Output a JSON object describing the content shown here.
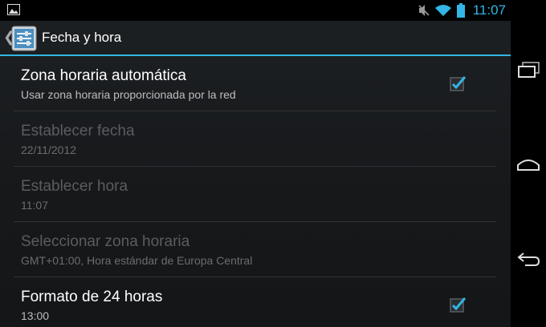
{
  "status_bar": {
    "time": "11:07",
    "icons": [
      "picture-icon",
      "mute-icon",
      "wifi-icon",
      "battery-icon"
    ]
  },
  "action_bar": {
    "title": "Fecha y hora",
    "icon": "settings-sliders-icon"
  },
  "settings": [
    {
      "title": "Zona horaria automática",
      "summary": "Usar zona horaria proporcionada por la red",
      "enabled": true,
      "checkbox": true,
      "checked": true
    },
    {
      "title": "Establecer fecha",
      "summary": "22/11/2012",
      "enabled": false,
      "checkbox": false
    },
    {
      "title": "Establecer hora",
      "summary": "11:07",
      "enabled": false,
      "checkbox": false
    },
    {
      "title": "Seleccionar zona horaria",
      "summary": "GMT+01:00, Hora estándar de Europa Central",
      "enabled": false,
      "checkbox": false
    },
    {
      "title": "Formato de 24 horas",
      "summary": "13:00",
      "enabled": true,
      "checkbox": true,
      "checked": true
    }
  ],
  "nav_bar": {
    "buttons": [
      "recent-apps-icon",
      "home-icon",
      "back-icon"
    ]
  },
  "colors": {
    "accent": "#33b5e5"
  }
}
